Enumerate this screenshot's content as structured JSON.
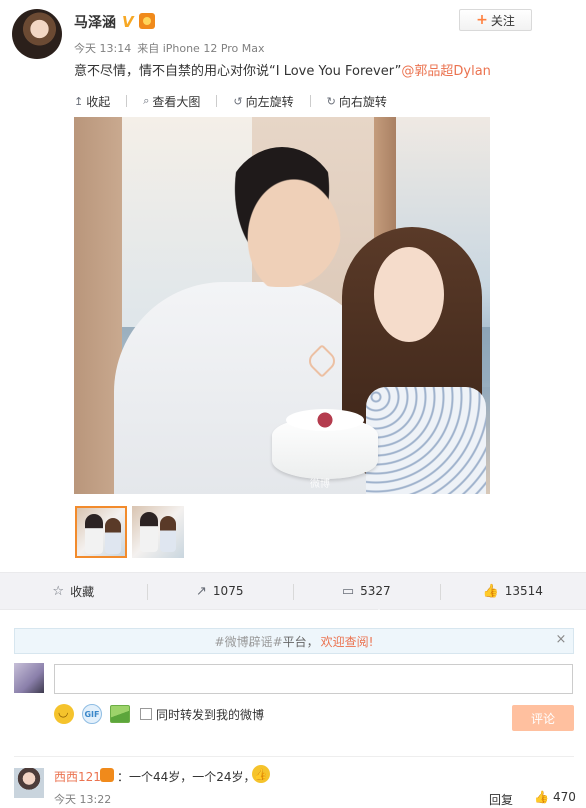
{
  "post": {
    "author": "马泽涵",
    "verified_mark": "V",
    "follow_label": "关注",
    "follow_plus": "+",
    "time": "今天 13:14",
    "source": "来自 iPhone 12 Pro Max",
    "text": "意不尽情，情不自禁的用心对你说“I Love You Forever”",
    "mention": "@郭品超Dylan"
  },
  "media_toolbar": {
    "items": [
      {
        "icon": "↥",
        "label": "收起"
      },
      {
        "icon": "⌕",
        "label": "查看大图"
      },
      {
        "icon": "↺",
        "label": "向左旋转"
      },
      {
        "icon": "↻",
        "label": "向右旋转"
      }
    ],
    "watermark": "微博"
  },
  "actions": {
    "favorite": {
      "icon": "☆",
      "label": "收藏"
    },
    "repost": {
      "icon": "↗",
      "label": "1075"
    },
    "comment": {
      "icon": "▭",
      "label": "5327"
    },
    "like": {
      "icon": "👍",
      "label": "13514"
    }
  },
  "comment_box": {
    "notice_hash": "#微博辟谣#",
    "notice_platform": "平台，",
    "notice_welcome": "欢迎查阅!",
    "close_symbol": "×",
    "input_value": "",
    "gif_label": "GIF",
    "repost_label": "同时转发到我的微博",
    "submit_label": "评论"
  },
  "comments": [
    {
      "user": "西西121",
      "text": "：一个44岁，一个24岁，",
      "time": "今天 13:22",
      "reply_label": "回复",
      "like_icon": "👍",
      "like_count": "470"
    }
  ],
  "colors": {
    "accent_orange": "#eb7350",
    "verified_gold": "#f7a824",
    "submit_disabled": "#ffc09f",
    "action_bar_bg": "#f2f2f5"
  }
}
